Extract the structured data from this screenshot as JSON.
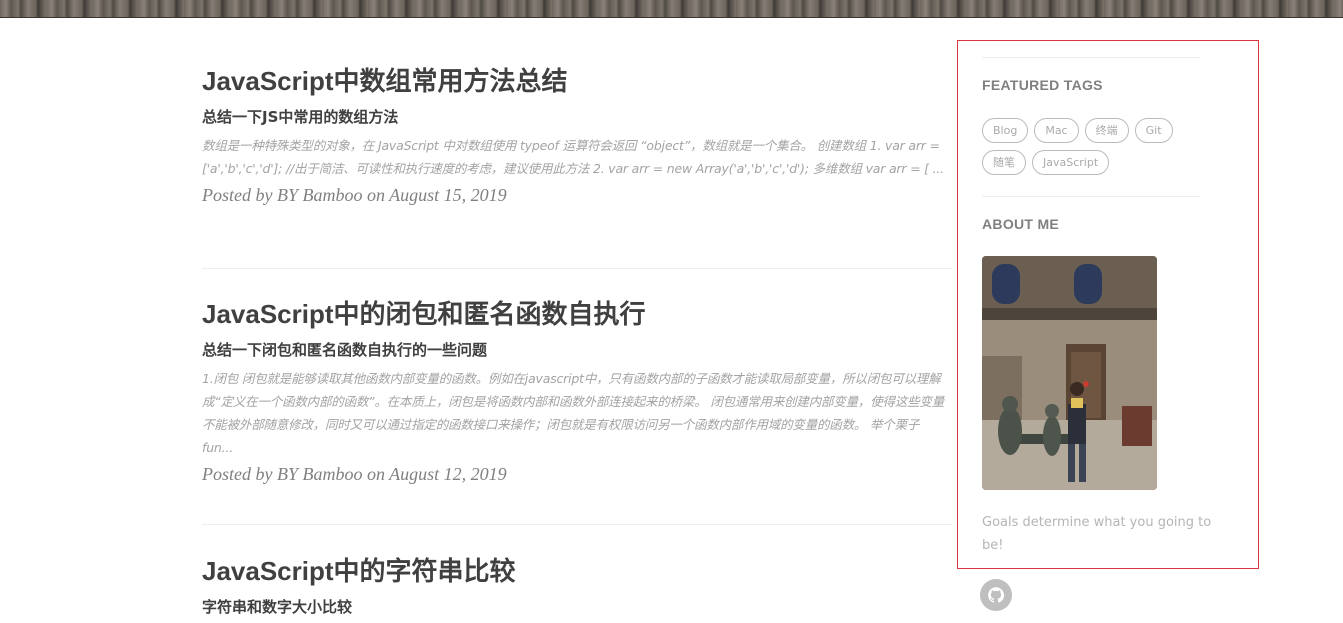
{
  "posts": [
    {
      "title": "JavaScript中数组常用方法总结",
      "subtitle": "总结一下JS中常用的数组方法",
      "excerpt": "数组是一种特殊类型的对象，在 JavaScript 中对数组使用 typeof 运算符会返回 “object”，数组就是一个集合。 创建数组 1. var arr = ['a','b','c','d']; //出于简洁、可读性和执行速度的考虑，建议使用此方法 2. var arr = new Array('a','b','c','d'); 多维数组 var arr = [ ...",
      "meta": "Posted by BY Bamboo on August 15, 2019"
    },
    {
      "title": "JavaScript中的闭包和匿名函数自执行",
      "subtitle": "总结一下闭包和匿名函数自执行的一些问题",
      "excerpt": "1.闭包 闭包就是能够读取其他函数内部变量的函数。例如在javascript中，只有函数内部的子函数才能读取局部变量，所以闭包可以理解成“定义在一个函数内部的函数”。在本质上，闭包是将函数内部和函数外部连接起来的桥梁。 闭包通常用来创建内部变量，使得这些变量不能被外部随意修改，同时又可以通过指定的函数接口来操作；闭包就是有权限访问另一个函数内部作用域的变量的函数。 举个栗子 fun...",
      "meta": "Posted by BY Bamboo on August 12, 2019"
    },
    {
      "title": "JavaScript中的字符串比较",
      "subtitle": "字符串和数字大小比较"
    }
  ],
  "sidebar": {
    "featured_heading": "FEATURED TAGS",
    "tags": [
      "Blog",
      "Mac",
      "终端",
      "Git",
      "随笔",
      "JavaScript"
    ],
    "about_heading": "ABOUT ME",
    "about_text": "Goals determine what you going to be!"
  },
  "icons": {
    "social": "github-icon"
  },
  "colors": {
    "sidebar_border": "#d9363e",
    "tag_border": "#bbbbbb",
    "text": "#404040"
  }
}
